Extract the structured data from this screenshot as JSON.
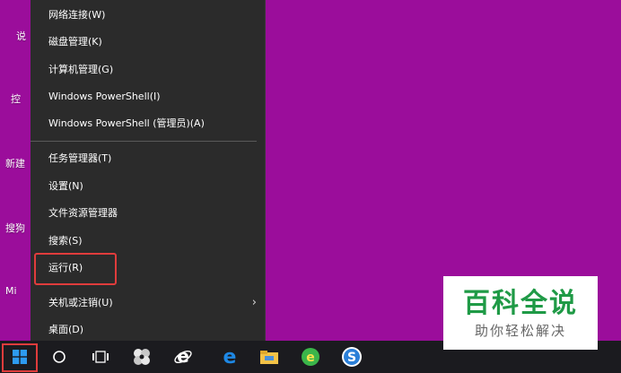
{
  "desktop": {
    "icon_labels": [
      "说",
      "控",
      "新建",
      "搜狗",
      "Mi"
    ]
  },
  "context_menu": {
    "items": [
      {
        "label": "网络连接(W)"
      },
      {
        "label": "磁盘管理(K)"
      },
      {
        "label": "计算机管理(G)"
      },
      {
        "label": "Windows PowerShell(I)"
      },
      {
        "label": "Windows PowerShell (管理员)(A)"
      },
      {
        "label": "任务管理器(T)"
      },
      {
        "label": "设置(N)"
      },
      {
        "label": "文件资源管理器"
      },
      {
        "label": "搜索(S)"
      },
      {
        "label": "运行(R)"
      },
      {
        "label": "关机或注销(U)",
        "submenu_arrow": "›"
      },
      {
        "label": "桌面(D)"
      }
    ],
    "highlighted_item": "运行(R)"
  },
  "taskbar": {
    "icons": [
      "windows-start-icon",
      "cortana-search-icon",
      "task-view-icon",
      "pinwheel-app-icon",
      "internet-explorer-icon",
      "edge-icon",
      "file-explorer-icon",
      "360-browser-icon",
      "sogou-browser-icon"
    ]
  },
  "watermark": {
    "title": "百科全说",
    "subtitle": "助你轻松解决"
  },
  "colors": {
    "desktop_bg": "#9b0d9b",
    "menu_bg": "#2b2b2b",
    "taskbar_bg": "#1b1b1f",
    "highlight": "#e03c3c",
    "watermark_green": "#1f9a46"
  }
}
